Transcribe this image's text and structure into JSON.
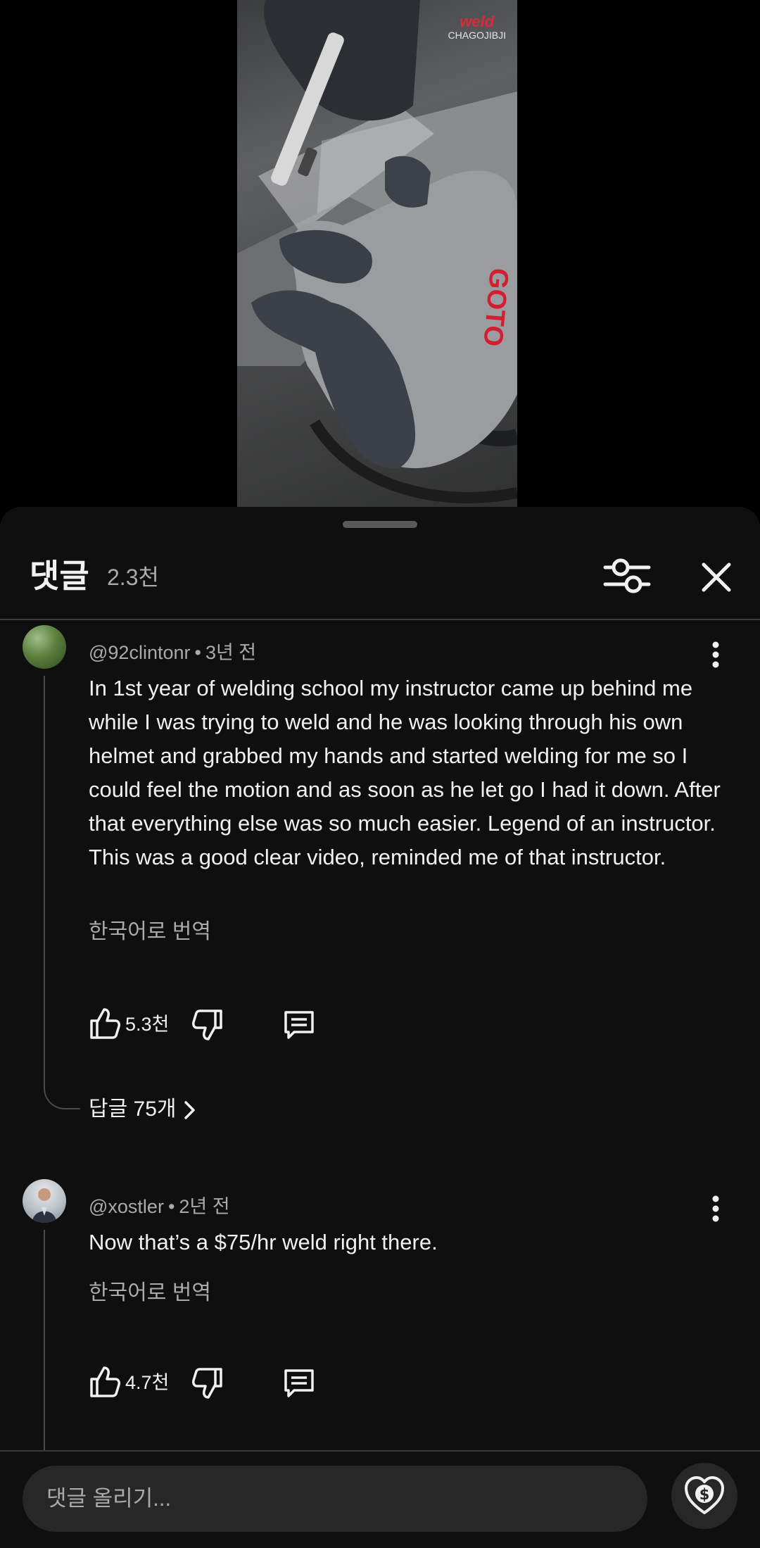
{
  "video": {
    "watermark_brand": "weld",
    "watermark_sub": "CHAGOJIBJI"
  },
  "sheet": {
    "title": "댓글",
    "count": "2.3천"
  },
  "comments": [
    {
      "author": "@92clintonr",
      "time": "3년 전",
      "text": "In 1st year of welding school my instructor came up behind me while I was trying to weld and he was looking through his own helmet and grabbed my hands and started welding for me so I could feel the motion and as soon as he let go I had it down. After that everything else was so much easier. Legend of an instructor. This was a good clear video, reminded me of that instructor.",
      "translate": "한국어로 번역",
      "likes": "5.3천",
      "replies": "답글 75개"
    },
    {
      "author": "@xostler",
      "time": "2년 전",
      "text": "Now that’s a $75/hr weld right there.",
      "translate": "한국어로 번역",
      "likes": "4.7천"
    }
  ],
  "composer": {
    "placeholder": "댓글 올리기..."
  },
  "icons": {
    "filter": "sliders-icon",
    "close": "close-icon",
    "more": "more-vertical-icon",
    "like": "thumbs-up-icon",
    "dislike": "thumbs-down-icon",
    "reply": "comment-icon",
    "replies": "chevron-right-icon",
    "thanks": "super-thanks-heart-dollar-icon"
  },
  "colors": {
    "sheet_background": "#0f0f0f",
    "text_primary": "#f1f1f1",
    "text_secondary": "#aaaaaa",
    "input_background": "#272727"
  }
}
